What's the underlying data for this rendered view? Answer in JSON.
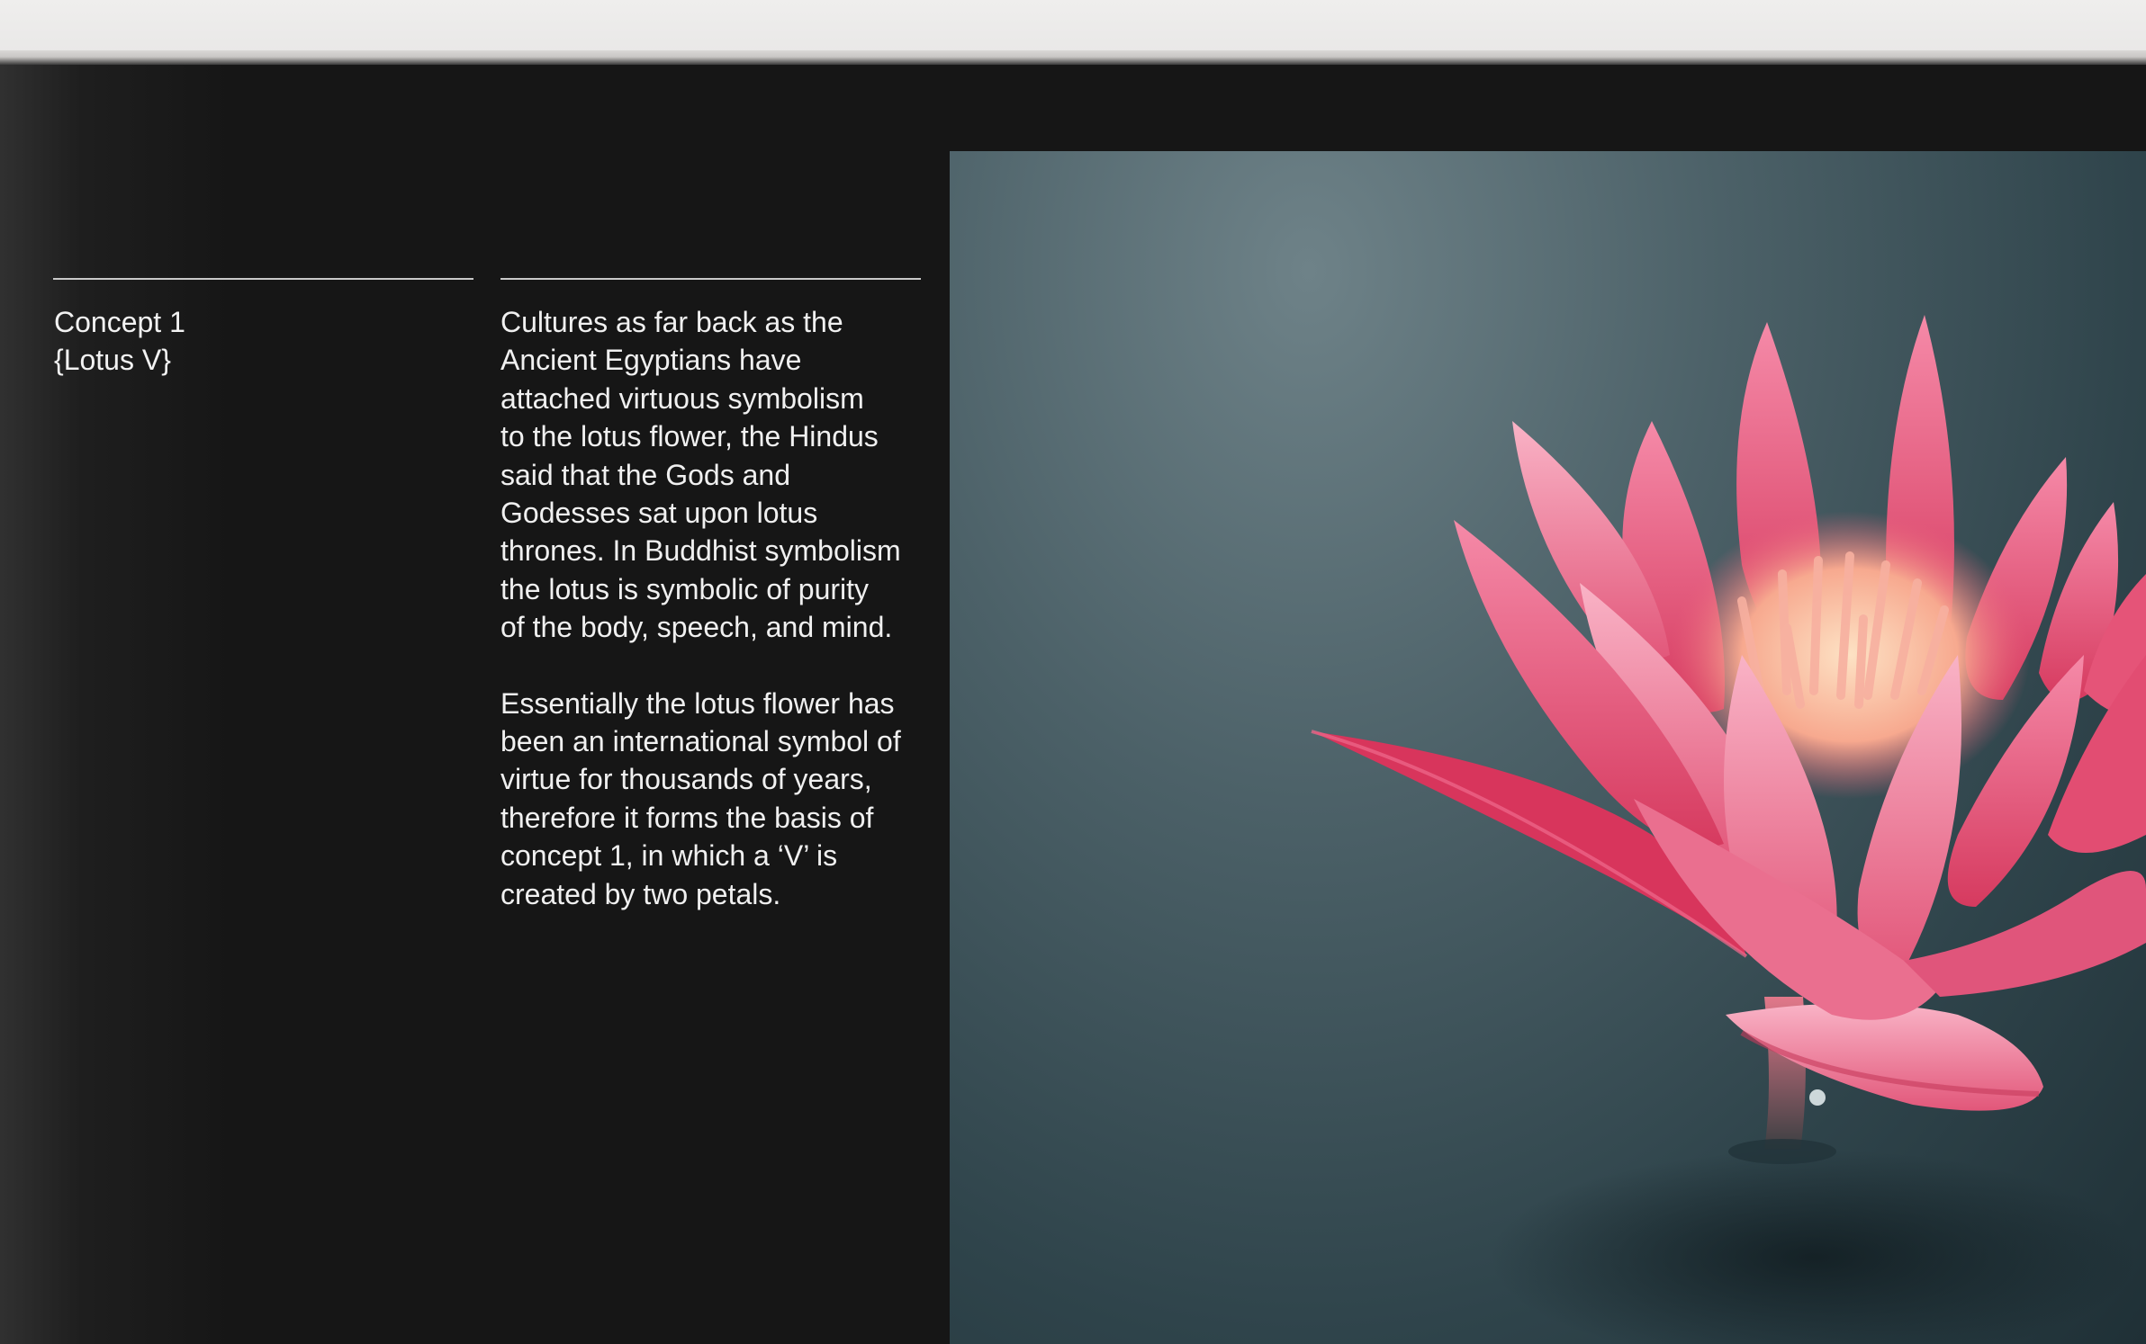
{
  "concept": {
    "title_line1": "Concept 1",
    "title_line2": "{Lotus V}"
  },
  "body": {
    "paragraph1": "Cultures as far back as the\nAncient Egyptians have\nattached virtuous symbolism\nto the lotus flower, the Hindus\nsaid that the Gods and\nGodesses sat upon lotus\nthrones. In Buddhist symbolism\nthe lotus is symbolic of purity\nof the body, speech, and mind.",
    "paragraph2": "Essentially the lotus flower has\nbeen an international symbol of\nvirtue for thousands of years,\ntherefore it forms the basis of\nconcept 1, in which a ‘V’ is\ncreated by two petals."
  },
  "photo": {
    "subject": "pink-lotus-flower",
    "colors": {
      "water": "#3f545b",
      "petal": "#e04a6e",
      "petal_light": "#f7a7bd",
      "center": "#f9c9a4"
    }
  }
}
